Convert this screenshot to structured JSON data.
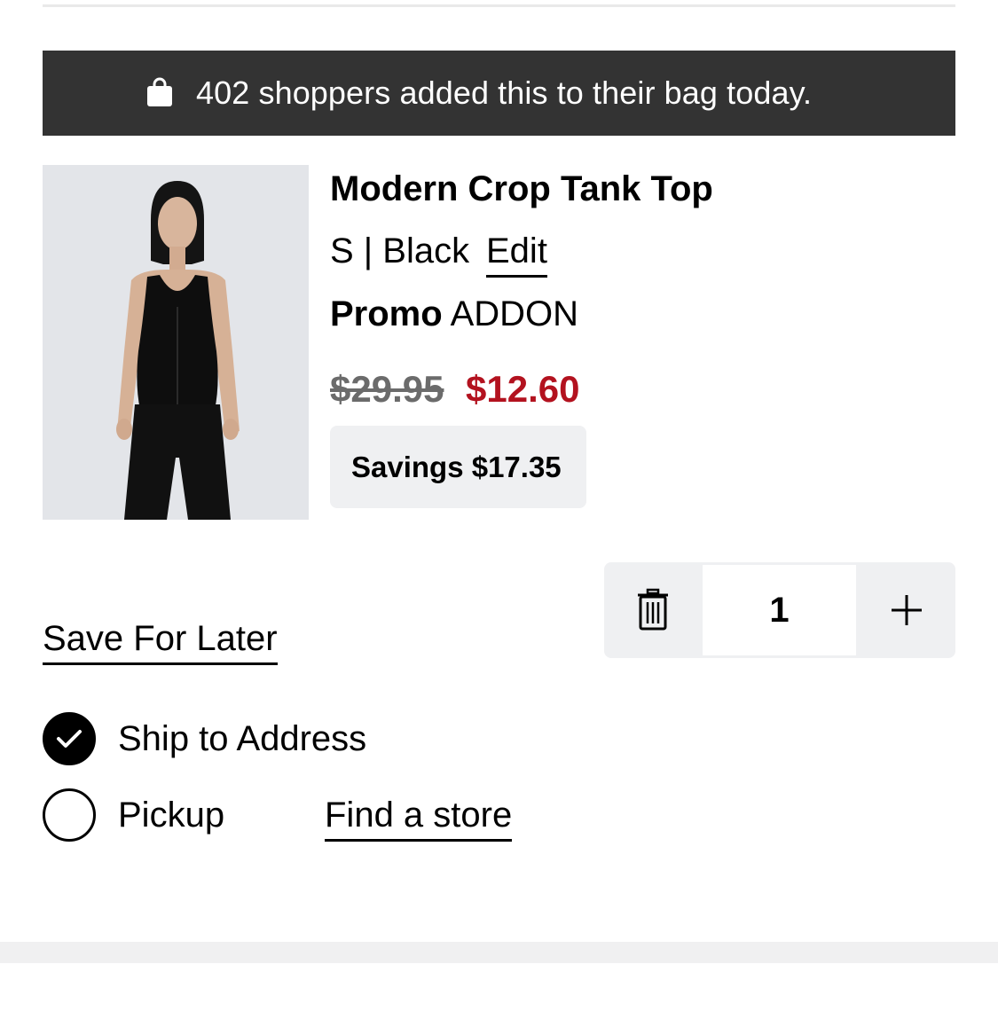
{
  "banner": {
    "text": "402 shoppers added this to their bag today."
  },
  "product": {
    "image_alt": "Model wearing black crop tank top and black jeans",
    "title": "Modern Crop Tank Top",
    "variant": "S | Black",
    "edit_label": "Edit",
    "promo_label": "Promo",
    "promo_code": "ADDON",
    "original_price": "$29.95",
    "sale_price": "$12.60",
    "savings": "Savings $17.35"
  },
  "actions": {
    "save_for_later": "Save For Later"
  },
  "quantity": {
    "value": "1"
  },
  "fulfillment": {
    "ship_label": "Ship to Address",
    "pickup_label": "Pickup",
    "find_store_label": "Find a store"
  },
  "colors": {
    "sale": "#b3121f",
    "banner_bg": "#333333",
    "chip_bg": "#eff0f2"
  }
}
